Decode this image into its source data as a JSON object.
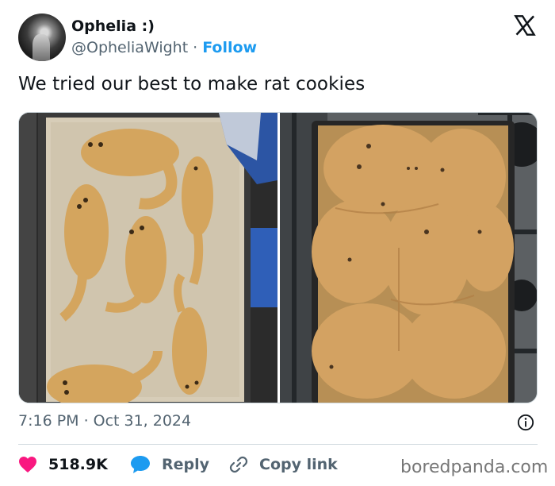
{
  "author": {
    "display_name": "Ophelia :)",
    "handle": "@OpheliaWight",
    "separator": "·",
    "follow_label": "Follow"
  },
  "tweet": {
    "text": "We tried our best to make rat cookies"
  },
  "meta": {
    "time": "7:16 PM",
    "separator": "·",
    "date": "Oct 31, 2024"
  },
  "actions": {
    "likes": "518.9K",
    "reply_label": "Reply",
    "copy_label": "Copy link"
  },
  "watermark": "boredpanda.com",
  "colors": {
    "like": "#f91880",
    "reply": "#1d9bf0",
    "follow": "#1d9bf0",
    "text": "#0f1419",
    "muted": "#536471"
  },
  "icons": [
    "x-logo-icon",
    "info-icon",
    "heart-icon",
    "reply-bubble-icon",
    "link-icon"
  ]
}
